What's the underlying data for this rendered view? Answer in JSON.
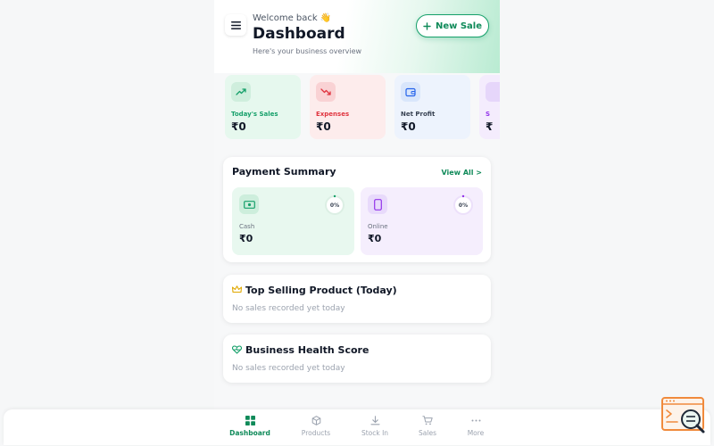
{
  "header": {
    "welcome": "Welcome back 👋",
    "title": "Dashboard",
    "subtitle": "Here's your business overview",
    "new_sale_label": "New Sale"
  },
  "stats": [
    {
      "label": "Today's Sales",
      "value": "₹0",
      "icon": "trending-up-icon",
      "color": "#16a06a"
    },
    {
      "label": "Expenses",
      "value": "₹0",
      "icon": "trending-down-icon",
      "color": "#e0343f"
    },
    {
      "label": "Net Profit",
      "value": "₹0",
      "icon": "wallet-icon",
      "color": "#374151"
    },
    {
      "label": "S",
      "value": "₹",
      "icon": "stat-icon",
      "color": "#9333ea"
    }
  ],
  "payment_summary": {
    "title": "Payment Summary",
    "view_all": "View All >",
    "cash": {
      "label": "Cash",
      "value": "₹0",
      "percent": "0%"
    },
    "online": {
      "label": "Online",
      "value": "₹0",
      "percent": "0%"
    }
  },
  "top_selling": {
    "title": "Top Selling Product (Today)",
    "empty": "No sales recorded yet today"
  },
  "health": {
    "title": "Business Health Score",
    "empty": "No sales recorded yet today"
  },
  "nav": [
    {
      "label": "Dashboard",
      "icon": "grid-icon",
      "active": true
    },
    {
      "label": "Products",
      "icon": "box-icon"
    },
    {
      "label": "Stock In",
      "icon": "download-icon"
    },
    {
      "label": "Sales",
      "icon": "cart-icon"
    },
    {
      "label": "More",
      "icon": "more-icon"
    }
  ],
  "colors": {
    "accent": "#16a06a",
    "danger": "#e0343f",
    "purple": "#9333ea"
  }
}
